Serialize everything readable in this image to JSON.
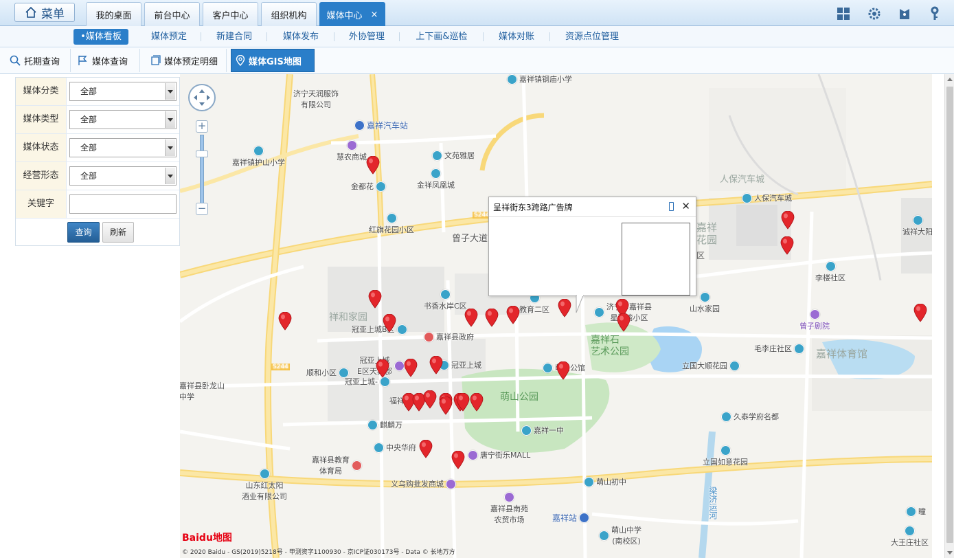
{
  "topbar": {
    "menu_label": "菜单",
    "tabs": [
      {
        "label": "我的桌面",
        "active": false
      },
      {
        "label": "前台中心",
        "active": false
      },
      {
        "label": "客户中心",
        "active": false
      },
      {
        "label": "组织机构",
        "active": false
      },
      {
        "label": "媒体中心",
        "active": true,
        "close": "×"
      }
    ],
    "icons": [
      "grid-icon",
      "gear-icon",
      "user-icon",
      "key-icon"
    ]
  },
  "nav2": {
    "items": [
      {
        "label": "•媒体看板",
        "active": true
      },
      {
        "label": "媒体预定"
      },
      {
        "label": "新建合同"
      },
      {
        "label": "媒体发布"
      },
      {
        "label": "外协管理"
      },
      {
        "label": "上下画&巡检"
      },
      {
        "label": "媒体对账"
      },
      {
        "label": "资源点位管理"
      }
    ]
  },
  "nav3": {
    "items": [
      {
        "label": "托期查询",
        "icon": "search-icon"
      },
      {
        "label": "媒体查询",
        "icon": "flag-icon"
      },
      {
        "label": "媒体预定明细",
        "icon": "document-icon"
      },
      {
        "label": "媒体GIS地图",
        "icon": "map-pin-icon",
        "active": true
      }
    ]
  },
  "filter": {
    "rows": [
      {
        "label": "媒体分类",
        "value": "全部"
      },
      {
        "label": "媒体类型",
        "value": "全部"
      },
      {
        "label": "媒体状态",
        "value": "全部"
      },
      {
        "label": "经营形态",
        "value": "全部"
      },
      {
        "label": "关键字",
        "value": ""
      }
    ],
    "query_button": "查询",
    "refresh_button": "刷新"
  },
  "map": {
    "poi": [
      {
        "name": "嘉祥镇钢庙小学",
        "type": "school"
      },
      {
        "name": "济宁天润服饰\n有限公司",
        "type": "company"
      },
      {
        "name": "嘉祥汽车站",
        "type": "bus"
      },
      {
        "name": "慧农商城",
        "type": "shop"
      },
      {
        "name": "文苑雅居",
        "type": "residence"
      },
      {
        "name": "嘉祥镇护山小学",
        "type": "school"
      },
      {
        "name": "金都花",
        "type": "residence"
      },
      {
        "name": "金祥凤凰城",
        "type": "residence"
      },
      {
        "name": "红旗花园小区",
        "type": "residence"
      },
      {
        "name": "人保汽车城",
        "type": "company"
      },
      {
        "name": "诚祥大阳",
        "type": "residence"
      },
      {
        "name": "李楼社区",
        "type": "residence"
      },
      {
        "name": "书香水岸C区",
        "type": "residence"
      },
      {
        "name": "教育二区",
        "type": "residence"
      },
      {
        "name": "济宁市嘉祥县\n星河湾小区",
        "type": "residence"
      },
      {
        "name": "山水家园",
        "type": "residence"
      },
      {
        "name": "曾子剧院",
        "type": "shop"
      },
      {
        "name": "冠亚上城B区",
        "type": "residence"
      },
      {
        "name": "嘉祥县政府",
        "type": "gov"
      },
      {
        "name": "冠亚上城\nE区天鹅郡",
        "type": "residence"
      },
      {
        "name": "冠亚上城",
        "type": "residence"
      },
      {
        "name": "萌山公馆",
        "type": "residence"
      },
      {
        "name": "毛李庄社区",
        "type": "residence"
      },
      {
        "name": "立国大顺花园",
        "type": "residence"
      },
      {
        "name": "顺和小区",
        "type": "residence"
      },
      {
        "name": "冠亚上城-",
        "type": "residence"
      },
      {
        "name": "嘉祥县卧龙山\n中学",
        "type": "school"
      },
      {
        "name": "福祥",
        "type": "residence"
      },
      {
        "name": "麒麟万",
        "type": "residence"
      },
      {
        "name": "嘉祥一中",
        "type": "school"
      },
      {
        "name": "久泰学府名都",
        "type": "residence"
      },
      {
        "name": "中央华府",
        "type": "residence"
      },
      {
        "name": "唐宁街乐MALL",
        "type": "shop"
      },
      {
        "name": "立国如意花园",
        "type": "residence"
      },
      {
        "name": "嘉祥县教育\n体育局",
        "type": "gov"
      },
      {
        "name": "义乌购批发商城",
        "type": "shop"
      },
      {
        "name": "萌山初中",
        "type": "school"
      },
      {
        "name": "山东红太阳\n酒业有限公司",
        "type": "company"
      },
      {
        "name": "嘉祥县南苑\n农贸市场",
        "type": "shop"
      },
      {
        "name": "嘉祥站",
        "type": "bus"
      },
      {
        "name": "萌山中学\n(南校区)",
        "type": "school"
      },
      {
        "name": "大王庄社区",
        "type": "residence"
      },
      {
        "name": "瞳",
        "type": "residence"
      }
    ],
    "areas": [
      "人保汽车城",
      "嘉祥",
      "花园",
      "区",
      "祥和家园",
      "嘉祥石",
      "艺术公园",
      "萌山公园",
      "嘉祥体育馆"
    ],
    "roads": [
      "曾子大道",
      "S244",
      "S244",
      "梁济运河"
    ],
    "info_window": {
      "title": "呈祥街东3跨路广告牌"
    },
    "zoom": {
      "in": "+",
      "out": "−"
    },
    "logo": "Baidu地图",
    "copyright": "© 2020 Baidu - GS(2019)5218号 - 甲测资字1100930 - 京ICP证030173号 - Data © 长地万方"
  }
}
